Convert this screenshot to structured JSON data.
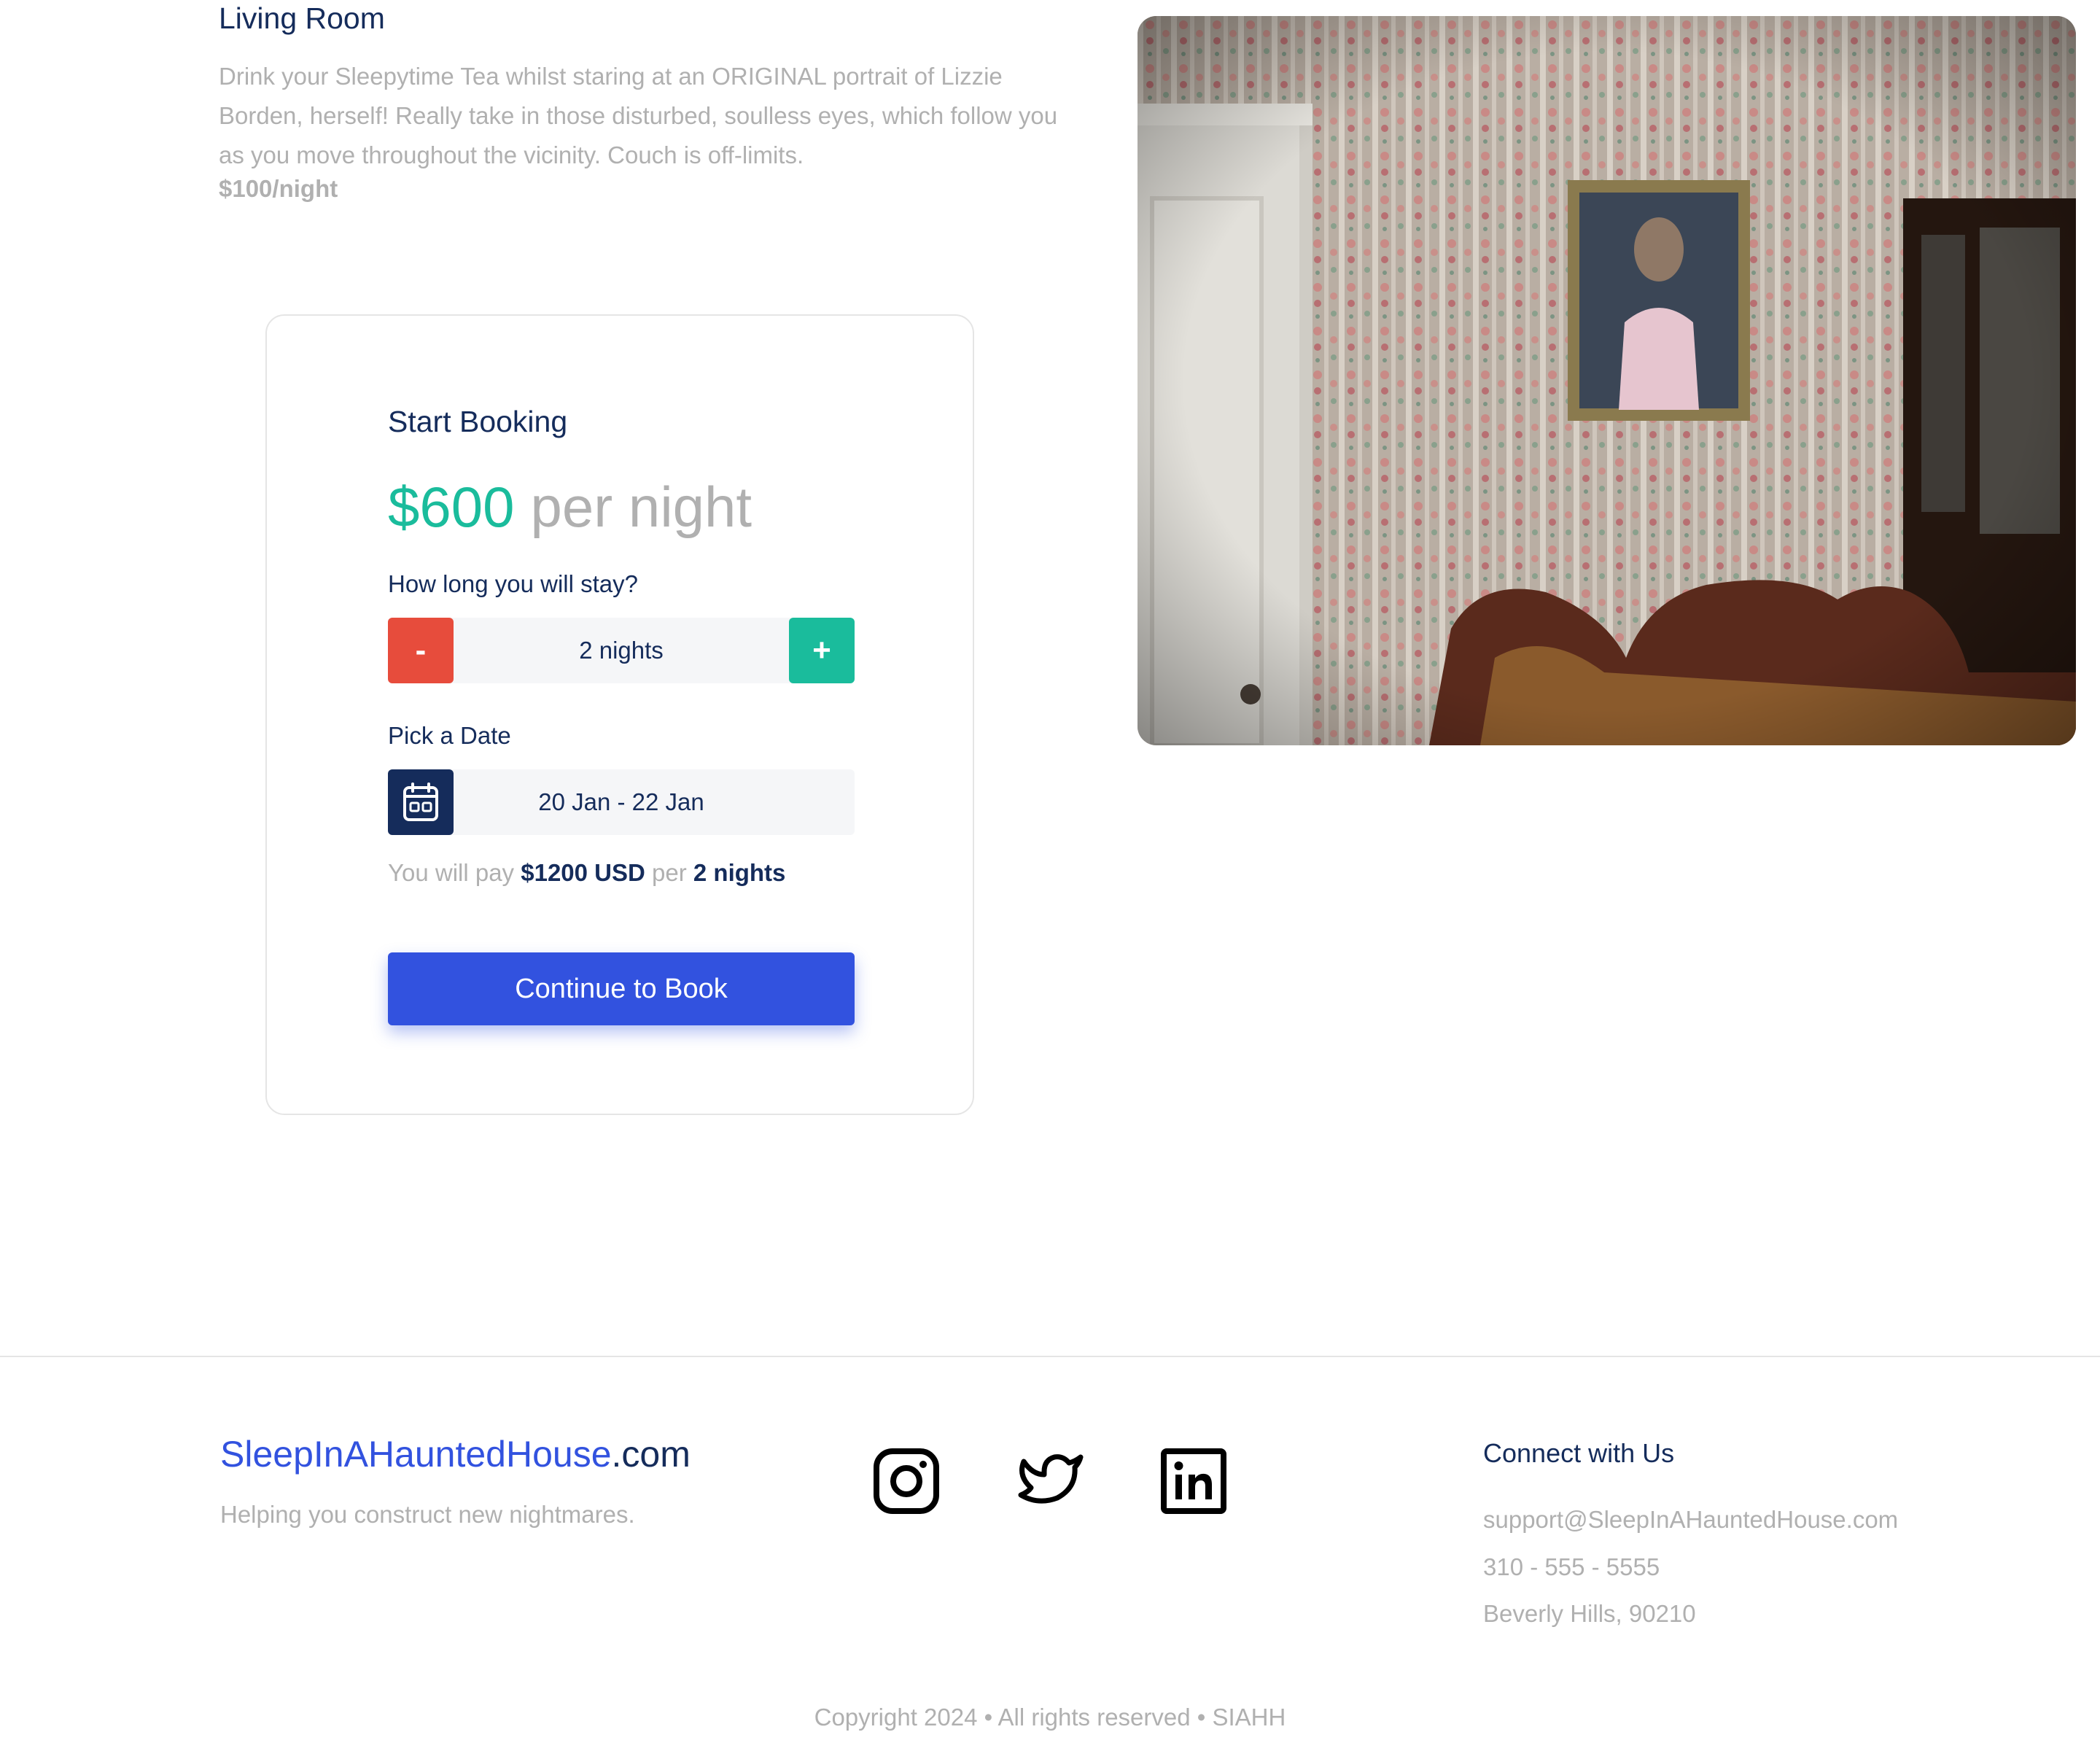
{
  "room": {
    "title": "Living Room",
    "description": "Drink your Sleepytime Tea whilst staring at an ORIGINAL portrait of Lizzie Borden, herself! Really take in those disturbed, soulless eyes, which follow you as you move throughout the vicinity. Couch is off-limits.",
    "price": "$100/night"
  },
  "booking": {
    "title": "Start Booking",
    "price_amount": "$600",
    "price_unit": "per night",
    "stay_label": "How long you will stay?",
    "nights_value": "2 nights",
    "minus_label": "-",
    "plus_label": "+",
    "date_label": "Pick a Date",
    "date_value": "20 Jan - 22 Jan",
    "pay_prefix": "You will pay",
    "pay_total": "$1200 USD",
    "pay_per": "per",
    "pay_nights": "2 nights",
    "continue_label": "Continue to Book"
  },
  "icons": {
    "calendar": "calendar-icon",
    "instagram": "instagram-icon",
    "twitter": "twitter-icon",
    "linkedin": "linkedin-icon"
  },
  "footer": {
    "brand_main": "SleepInAHauntedHouse",
    "brand_suffix": ".com",
    "tagline": "Helping you construct new nightmares.",
    "connect_title": "Connect with Us",
    "email": "support@SleepInAHauntedHouse.com",
    "phone": "310 - 555 - 5555",
    "address": "Beverly Hills, 90210",
    "copyright": "Copyright 2024 • All rights reserved • SIAHH"
  },
  "colors": {
    "primary": "#3252df",
    "navy": "#152c5b",
    "teal": "#1abc9c",
    "red": "#e74c3c",
    "muted": "#b0b0b0"
  }
}
